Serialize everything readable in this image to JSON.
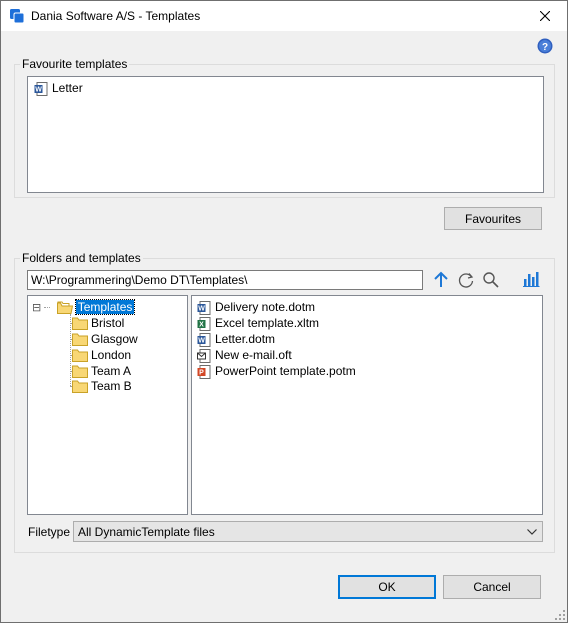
{
  "window": {
    "title": "Dania Software A/S - Templates"
  },
  "favourites": {
    "legend": "Favourite templates",
    "items": [
      {
        "label": "Letter",
        "icon": "word-doc-icon"
      }
    ],
    "button_label": "Favourites"
  },
  "folders": {
    "legend": "Folders and templates",
    "path": "W:\\Programmering\\Demo DT\\Templates\\",
    "tree": {
      "root": "Templates",
      "expander": "⊟",
      "children": [
        "Bristol",
        "Glasgow",
        "London",
        "Team A",
        "Team B"
      ]
    },
    "files": [
      {
        "label": "Delivery note.dotm",
        "icon": "word-doc-icon"
      },
      {
        "label": "Excel template.xltm",
        "icon": "excel-doc-icon"
      },
      {
        "label": "Letter.dotm",
        "icon": "word-doc-icon"
      },
      {
        "label": "New e-mail.oft",
        "icon": "email-doc-icon"
      },
      {
        "label": "PowerPoint template.potm",
        "icon": "powerpoint-doc-icon"
      }
    ]
  },
  "filetype": {
    "label": "Filetype",
    "selected": "All DynamicTemplate files"
  },
  "buttons": {
    "ok": "OK",
    "cancel": "Cancel"
  },
  "colors": {
    "accent": "#0078d7",
    "word": "#2b579a",
    "excel": "#217346",
    "powerpoint": "#d24726"
  }
}
